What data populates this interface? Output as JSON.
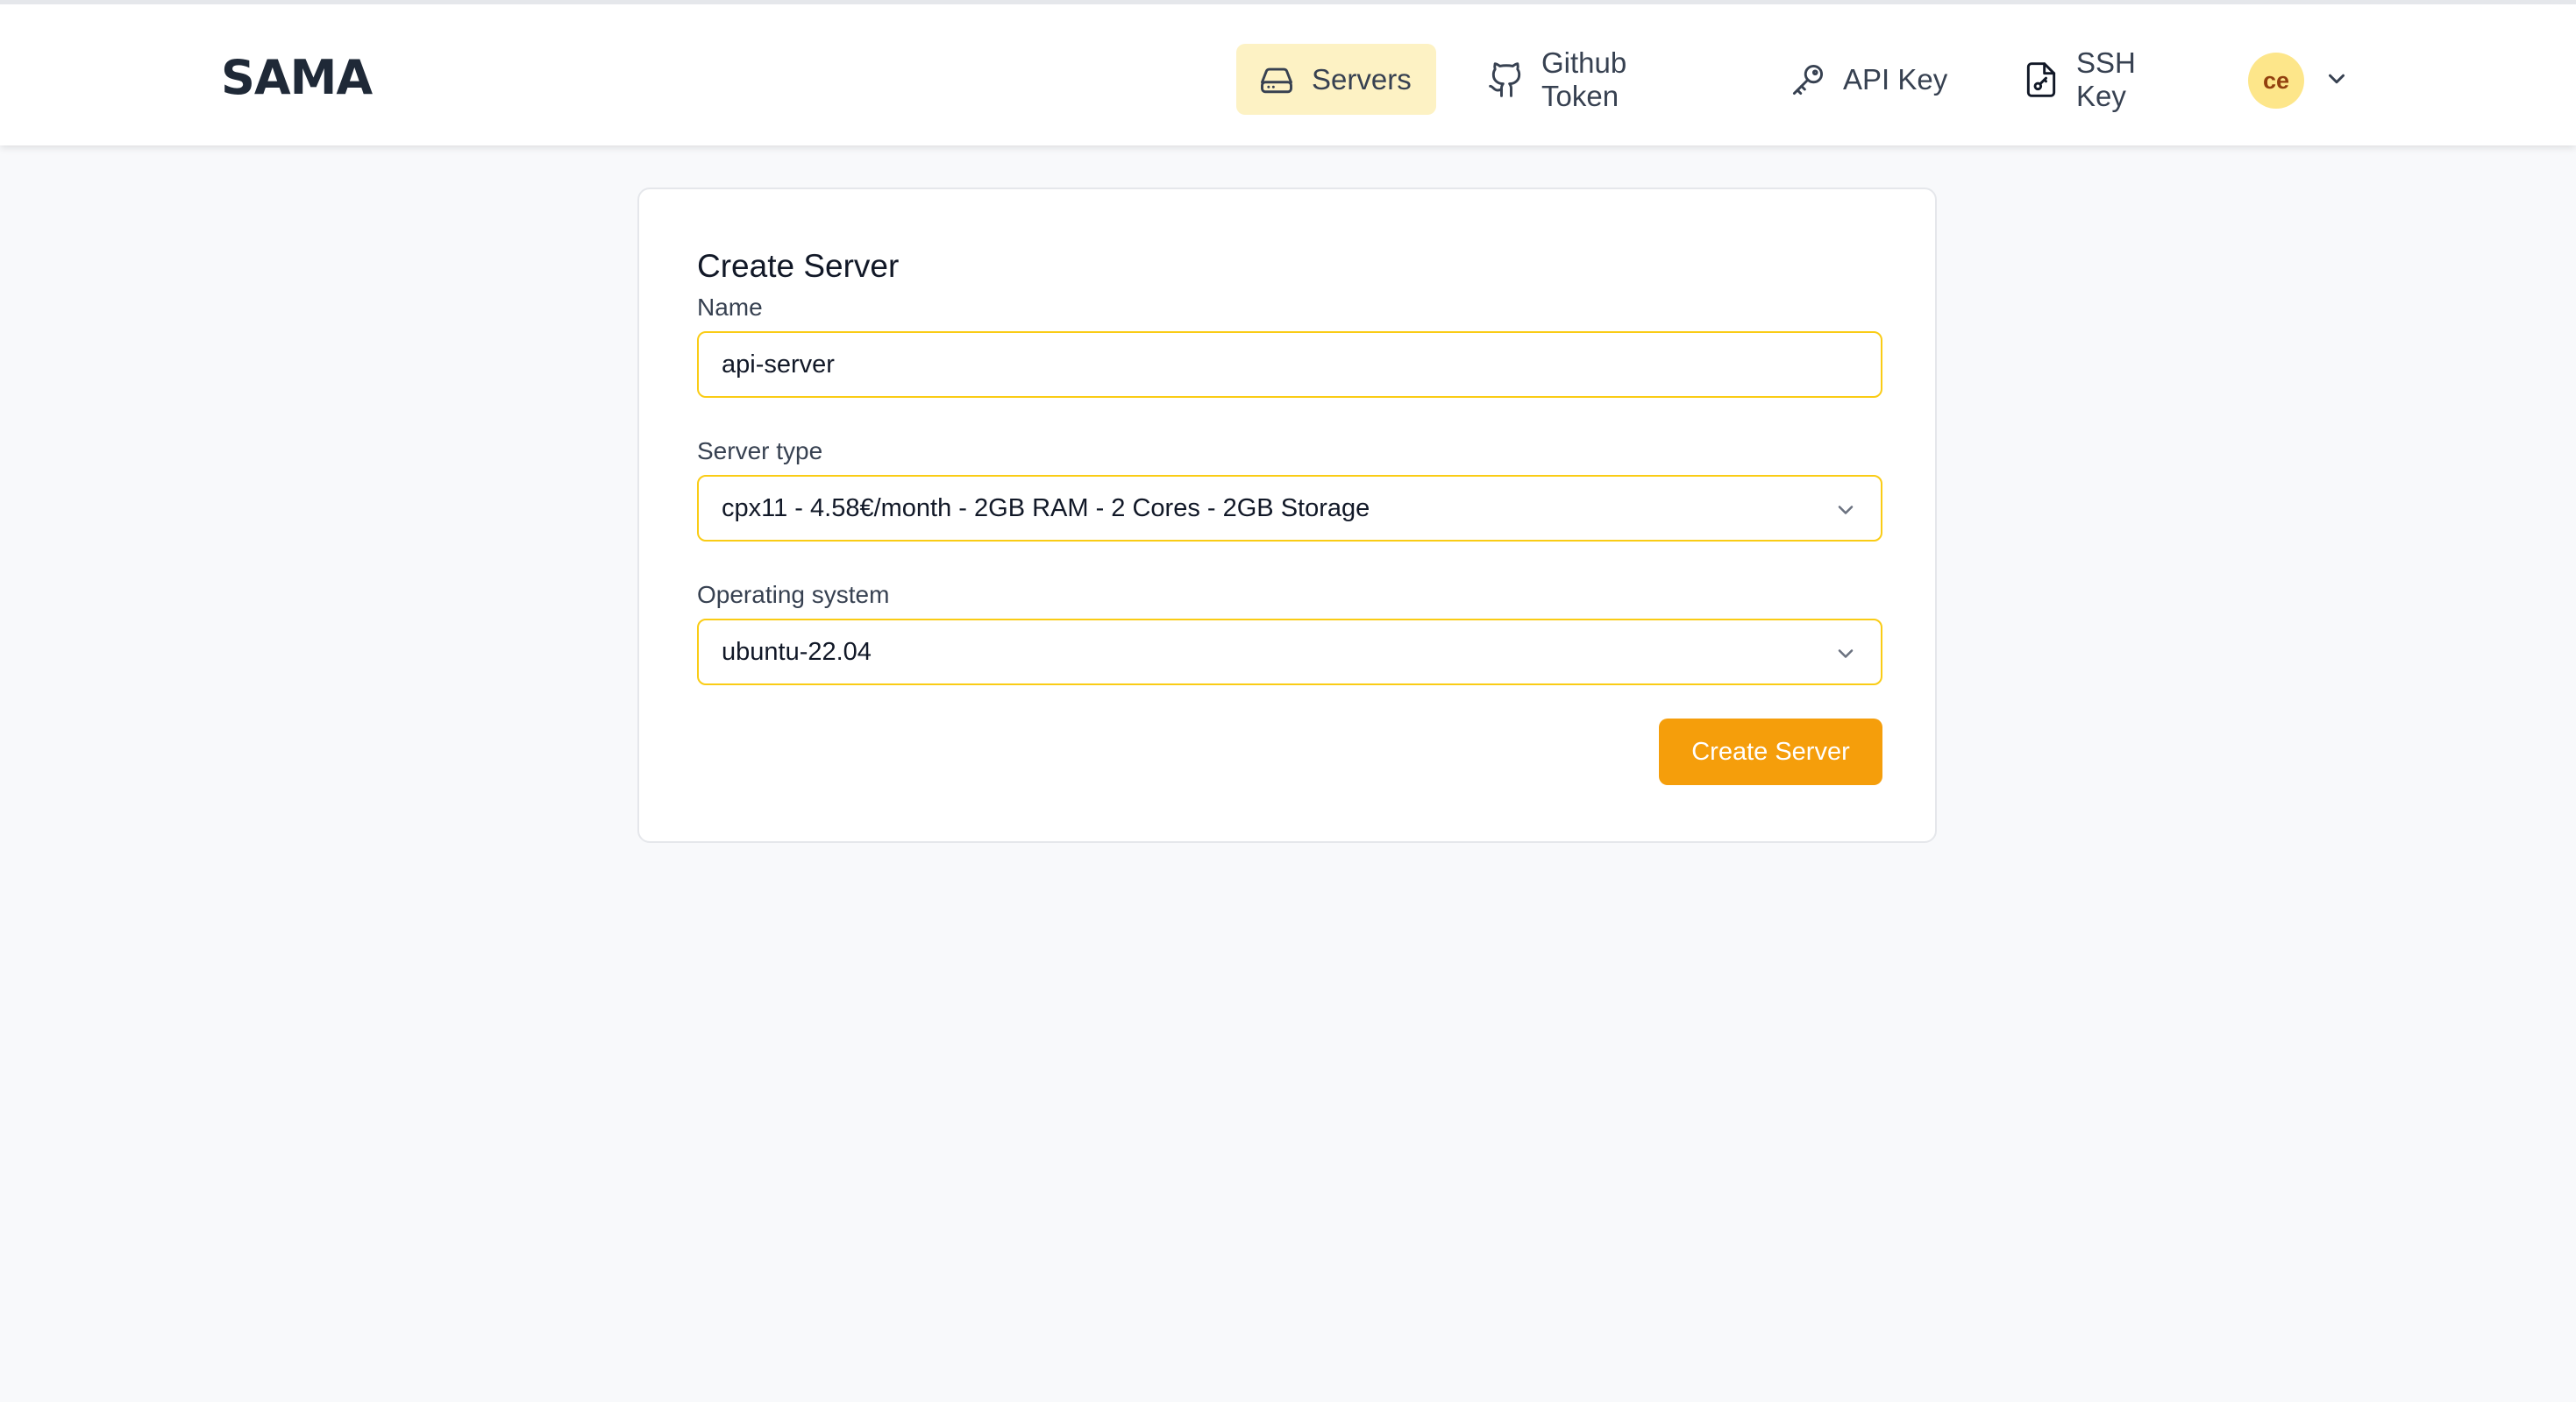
{
  "app": {
    "logo_text": "SAMA"
  },
  "nav": {
    "items": [
      {
        "label": "Servers",
        "icon": "server-icon",
        "active": true
      },
      {
        "label": "Github Token",
        "icon": "github-icon",
        "active": false
      },
      {
        "label": "API Key",
        "icon": "key-icon",
        "active": false
      },
      {
        "label": "SSH Key",
        "icon": "file-key-icon",
        "active": false
      }
    ],
    "avatar_initials": "ce",
    "avatar_menu_icon": "chevron-down-icon"
  },
  "form": {
    "title": "Create Server",
    "name_label": "Name",
    "name_value": "api-server",
    "server_type_label": "Server type",
    "server_type_value": "cpx11 - 4.58€/month - 2GB RAM - 2 Cores - 2GB Storage",
    "os_label": "Operating system",
    "os_value": "ubuntu-22.04",
    "submit_label": "Create Server"
  },
  "colors": {
    "accent": "#f59e0b",
    "active_nav_bg": "#fdf2c4",
    "field_border": "#facc15",
    "avatar_bg": "#fde68a",
    "avatar_text": "#92400e",
    "page_bg": "#f8f9fb"
  }
}
